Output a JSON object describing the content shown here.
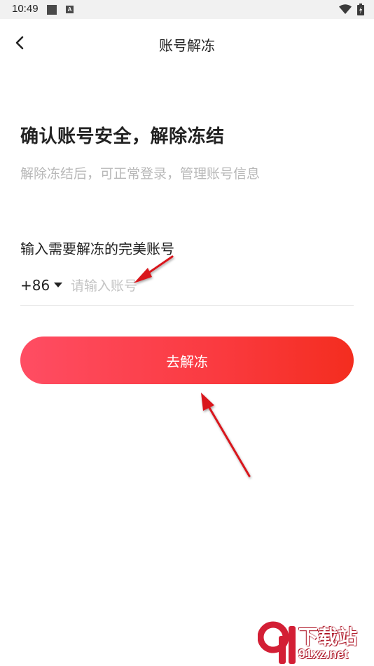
{
  "status_bar": {
    "time": "10:49",
    "notification_badge": "A",
    "icons": [
      "square-notification-icon",
      "a-notification-icon",
      "wifi-icon",
      "battery-icon"
    ]
  },
  "header": {
    "back_icon": "chevron-left-icon",
    "title": "账号解冻"
  },
  "main": {
    "headline": "确认账号安全，解除冻结",
    "subline": "解除冻结后，可正常登录，管理账号信息",
    "field_label": "输入需要解冻的完美账号",
    "country_code": "+86",
    "account_placeholder": "请输入账号",
    "account_value": "",
    "submit_label": "去解冻"
  },
  "annotations": {
    "arrow_color": "#d9141c"
  },
  "watermark": {
    "chinese": "下载站",
    "url": "91xz.net"
  },
  "colors": {
    "button_gradient_start": "#ff4d63",
    "button_gradient_end": "#f42d1f",
    "subtitle": "#b8b8b8",
    "placeholder": "#c4c4c4"
  }
}
